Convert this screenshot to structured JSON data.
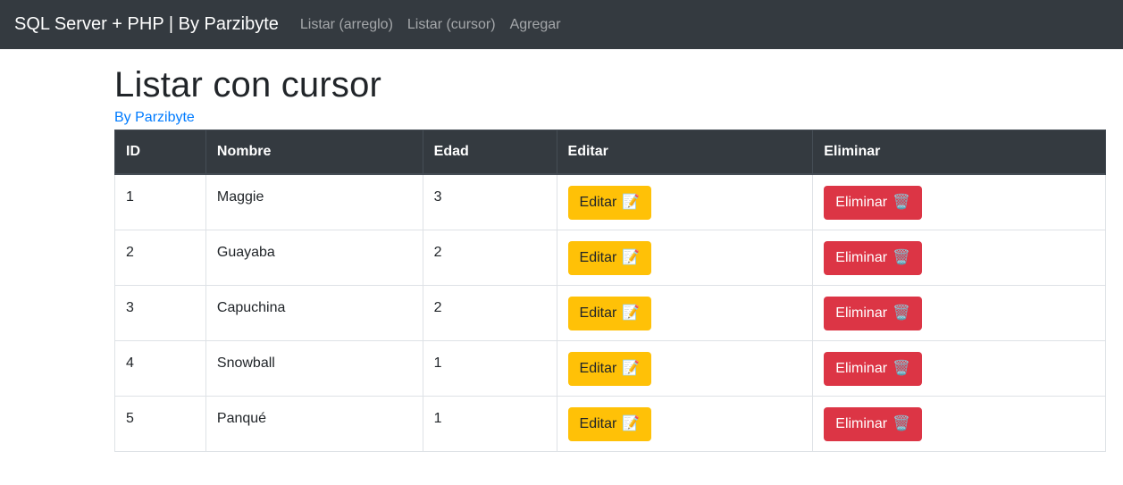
{
  "navbar": {
    "brand": "SQL Server + PHP | By Parzibyte",
    "links": [
      "Listar (arreglo)",
      "Listar (cursor)",
      "Agregar"
    ]
  },
  "page": {
    "title": "Listar con cursor",
    "byline": "By Parzibyte"
  },
  "table": {
    "headers": [
      "ID",
      "Nombre",
      "Edad",
      "Editar",
      "Eliminar"
    ],
    "rows": [
      {
        "id": "1",
        "nombre": "Maggie",
        "edad": "3"
      },
      {
        "id": "2",
        "nombre": "Guayaba",
        "edad": "2"
      },
      {
        "id": "3",
        "nombre": "Capuchina",
        "edad": "2"
      },
      {
        "id": "4",
        "nombre": "Snowball",
        "edad": "1"
      },
      {
        "id": "5",
        "nombre": "Panqué",
        "edad": "1"
      }
    ],
    "edit_label": "Editar",
    "edit_icon": "📝",
    "delete_label": "Eliminar",
    "delete_icon": "🗑️"
  },
  "colors": {
    "navbar": "#343a40",
    "link": "#007bff",
    "warning": "#ffc107",
    "danger": "#dc3545"
  }
}
